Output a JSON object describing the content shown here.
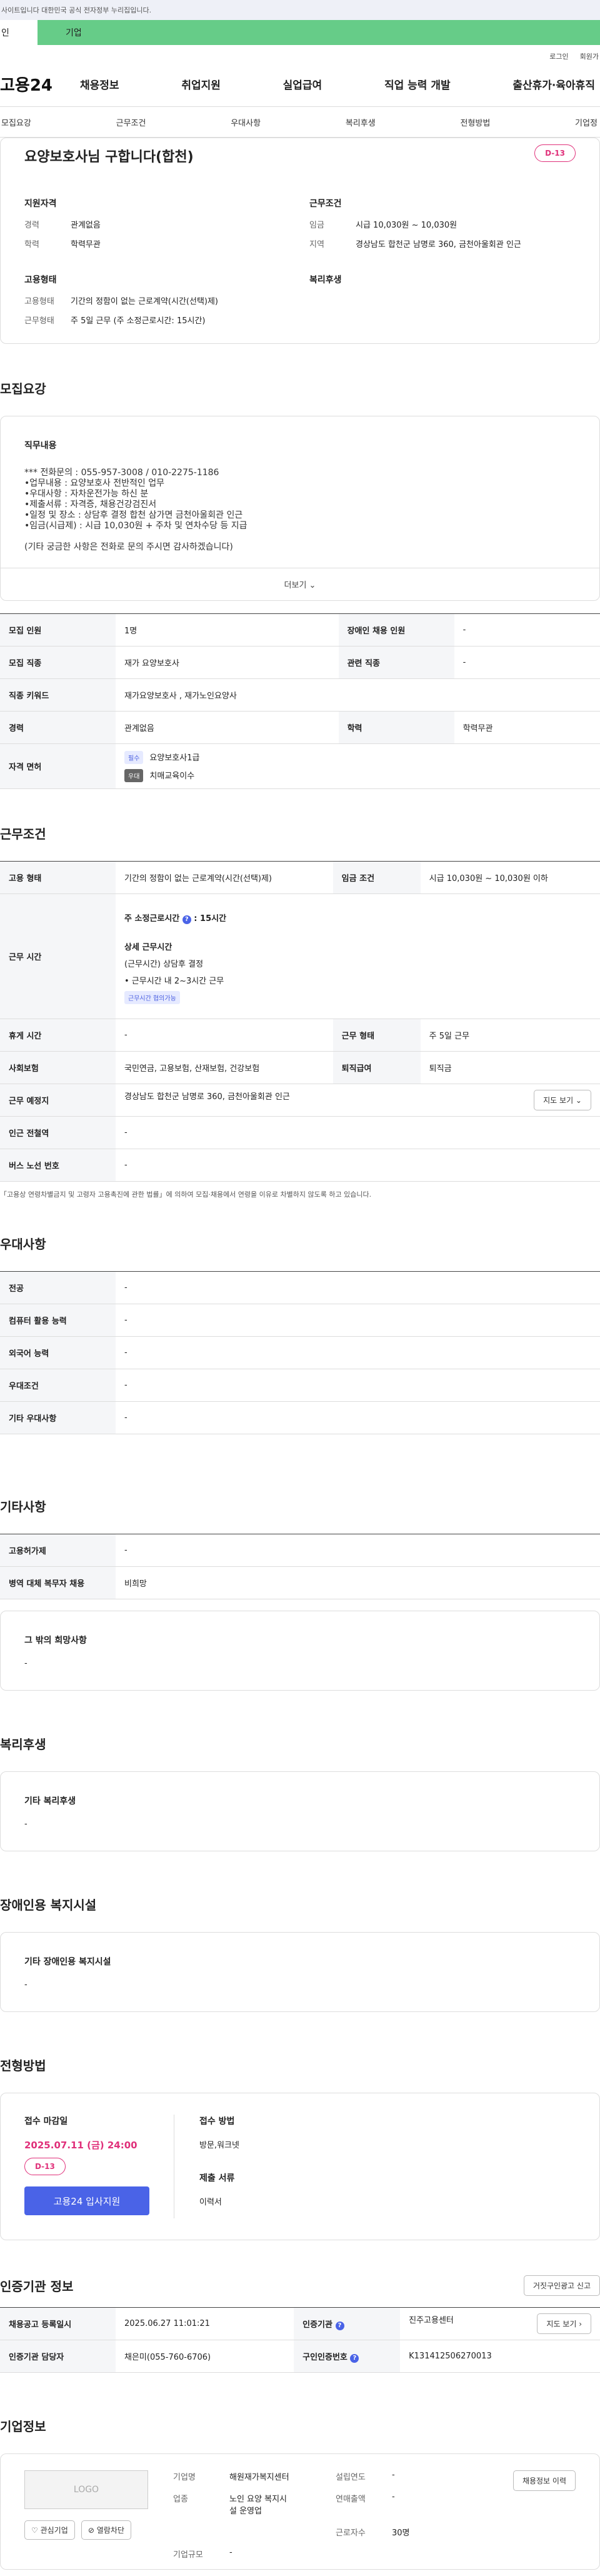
{
  "topbar": {
    "notice": "사이트입니다 대한민국 공식 전자정부 누리집입니다."
  },
  "tabs": {
    "personal": "인",
    "company": "기업"
  },
  "util": {
    "login": "로그인",
    "signup": "회원가"
  },
  "gnb": {
    "logo": "고용24",
    "menu": [
      "채용정보",
      "취업지원",
      "실업급여",
      "직업 능력 개발",
      "출산휴가·육아휴직"
    ]
  },
  "subnav": [
    "모집요강",
    "근무조건",
    "우대사항",
    "복리후생",
    "전형방법",
    "기업정"
  ],
  "summary": {
    "title": "요양보호사님 구합니다(합천)",
    "dday": "D-13",
    "qual_title": "지원자격",
    "qual": [
      {
        "k": "경력",
        "v": "관계없음"
      },
      {
        "k": "학력",
        "v": "학력무관"
      }
    ],
    "work_title": "근무조건",
    "work": [
      {
        "k": "임금",
        "v": "시급 10,030원 ~ 10,030원"
      },
      {
        "k": "지역",
        "v": "경상남도 합천군 남명로 360, 금천아울회관 인근"
      }
    ],
    "emp_title": "고용형태",
    "emp": [
      {
        "k": "고용형태",
        "v": "기간의 정함이 없는 근로계약(시간(선택)제)"
      },
      {
        "k": "근무형태",
        "v": "주 5일 근무 (주 소정근로시간: 15시간)"
      }
    ],
    "welfare_title": "복리후생"
  },
  "recruit": {
    "title": "모집요강",
    "job_title": "직무내용",
    "desc": [
      "*** 전화문의 : 055-957-3008 / 010-2275-1186",
      "•업무내용 : 요양보호사 전반적인 업무",
      "•우대사항 : 자차운전가능 하신 분",
      "•제출서류 : 자격증, 채용건강검진서",
      "•일정 및 장소 : 상담후 결정   합천 삼가면 금천아울회관 인근",
      "•임금(시급제) : 시급 10,030원 + 주차 및 연차수당 등 지급",
      "",
      "(기타 궁금한 사항은 전화로 문의 주시면 감사하겠습니다)"
    ],
    "more": "더보기 ⌄",
    "rows": {
      "count_k": "모집 인원",
      "count_v": "1명",
      "disabled_k": "장애인 채용 인원",
      "disabled_v": "-",
      "job_k": "모집 직종",
      "job_v": "재가 요양보호사",
      "related_k": "관련 직종",
      "related_v": "-",
      "keyword_k": "직종 키워드",
      "keyword_v": "재가요양보호사 , 재가노인요양사",
      "career_k": "경력",
      "career_v": "관계없음",
      "edu_k": "학력",
      "edu_v": "학력무관",
      "license_k": "자격 면허",
      "badge_ess": "필수",
      "license1": "요양보호사1급",
      "badge_pref": "우대",
      "license2": "치매교육이수"
    }
  },
  "work": {
    "title": "근무조건",
    "type_k": "고용 형태",
    "type_v": "기간의 정함이 없는 근로계약(시간(선택)제)",
    "wage_k": "임금 조건",
    "wage_v": "시급 10,030원 ~ 10,030원 이하",
    "time_k": "근무 시간",
    "time_main": "주 소정근로시간",
    "time_hours": "15시간",
    "time_detail_title": "상세 근무시간",
    "time_detail1": "(근무시간)  상담후 결정",
    "time_detail2": "• 근무시간 내 2~3시간 근무",
    "time_badge": "근무시간 협의가능",
    "holiday_k": "휴게 시간",
    "holiday_v": "-",
    "worktype_k": "근무 형태",
    "worktype_v": "주 5일 근무",
    "insurance_k": "사회보험",
    "insurance_v": "국민연금, 고용보험, 산재보험, 건강보험",
    "retire_k": "퇴직급여",
    "retire_v": "퇴직금",
    "place_k": "근무 예정지",
    "place_v": "경상남도 합천군 남명로 360, 금천아울회관 인근",
    "map_btn": "지도 보기 ⌄",
    "subway_k": "인근 전철역",
    "subway_v": "-",
    "bus_k": "버스 노선 번호",
    "bus_v": "-",
    "note": "「고용상 연령차별금지 및 고령자 고용촉진에 관한 법률」에 의하여 모집·채용에서 연령을 이유로 차별하지 않도록 하고 있습니다."
  },
  "pref": {
    "title": "우대사항",
    "rows": [
      {
        "k": "전공",
        "v": "-"
      },
      {
        "k": "컴퓨터 활용 능력",
        "v": "-"
      },
      {
        "k": "외국어 능력",
        "v": "-"
      },
      {
        "k": "우대조건",
        "v": "-"
      },
      {
        "k": "기타 우대사항",
        "v": "-"
      }
    ]
  },
  "etc": {
    "title": "기타사항",
    "rows": [
      {
        "k": "고용허가제",
        "v": "-"
      },
      {
        "k": "병역 대체 복무자 채용",
        "v": "비희망"
      }
    ],
    "other_title": "그 밖의 희망사항",
    "other_v": "-"
  },
  "welfare": {
    "title": "복리후생",
    "card_title": "기타 복리후생",
    "card_v": "-"
  },
  "disability": {
    "title": "장애인용 복지시설",
    "card_title": "기타 장애인용 복지시설",
    "card_v": "-"
  },
  "apply": {
    "title": "전형방법",
    "deadline_title": "접수 마감일",
    "deadline": "2025.07.11 (금) 24:00",
    "dday": "D-13",
    "btn": "고용24 입사지원",
    "method_title": "접수 방법",
    "method_v": "방문,워크넷",
    "docs_title": "제출 서류",
    "docs_v": "이력서"
  },
  "agency": {
    "title": "인증기관 정보",
    "report_btn": "거짓구인광고 신고",
    "reg_k": "채용공고 등록일시",
    "reg_v": "2025.06.27 11:01:21",
    "org_k": "인증기관",
    "org_v": "진주고용센터",
    "map_btn": "지도 보기 ›",
    "mgr_k": "인증기관 담당자",
    "mgr_v": "채은미(055-760-6706)",
    "num_k": "구인인증번호",
    "num_v": "K131412506270013"
  },
  "company": {
    "title": "기업정보",
    "logo": "LOGO",
    "fav_btn": "♡ 관심기업",
    "block_btn": "⊘ 열람차단",
    "recruit_btn": "채용정보 이력",
    "name_k": "기업명",
    "name_v": "해원재가복지센터",
    "year_k": "설립연도",
    "year_v": "-",
    "ind_k": "업종",
    "ind_v1": "노인 요양 복지시",
    "ind_v2": "설 운영업",
    "sales_k": "연매출액",
    "sales_v": "-",
    "emp_k": "근로자수",
    "emp_v": "30명",
    "size_k": "기업규모",
    "size_v": "-"
  }
}
